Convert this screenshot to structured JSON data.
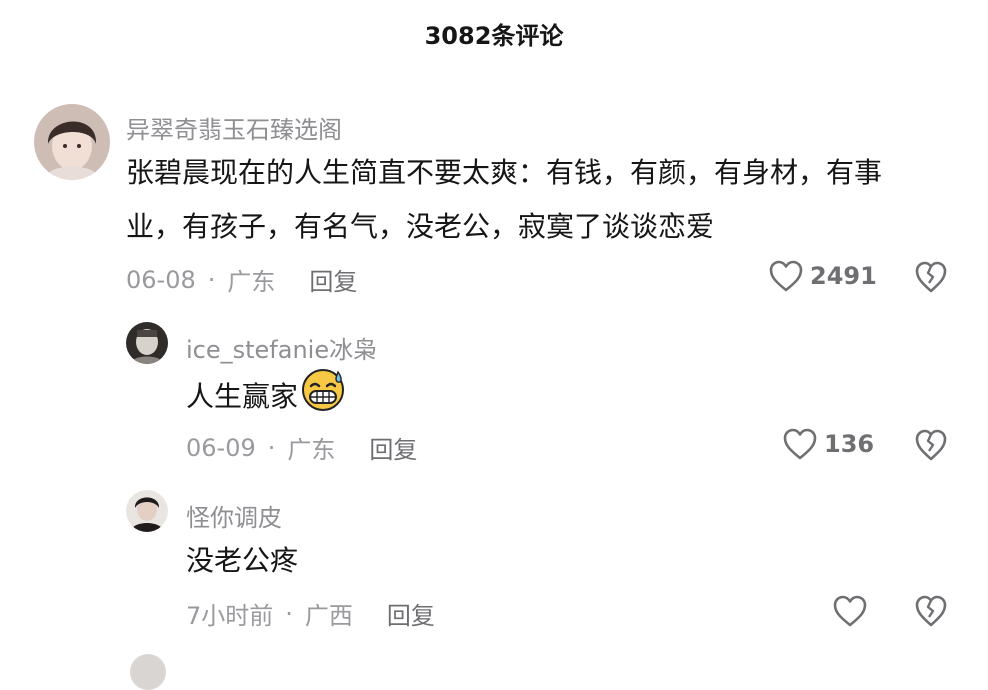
{
  "header": {
    "title": "3082条评论"
  },
  "comments": [
    {
      "username": "异翠奇翡玉石臻选阁",
      "text_line1": "张碧晨现在的人生简直不要太爽：有钱，有颜，有身材，有事",
      "text_line2": "业，有孩子，有名气，没老公，寂寞了谈谈恋爱",
      "date": "06-08",
      "separator": "·",
      "location": "广东",
      "reply_label": "回复",
      "likes": "2491"
    },
    {
      "username": "ice_stefanie冰枭",
      "text": "人生赢家",
      "emoji": "grinning-sweat-emoji",
      "date": "06-09",
      "separator": "·",
      "location": "广东",
      "reply_label": "回复",
      "likes": "136"
    },
    {
      "username": "怪你调皮",
      "text": "没老公疼",
      "date": "7小时前",
      "separator": "·",
      "location": "广西",
      "reply_label": "回复",
      "likes": ""
    }
  ],
  "icons": {
    "like": "heart-outline-icon",
    "dislike": "broken-heart-icon"
  },
  "colors": {
    "text_primary": "#161616",
    "text_secondary": "#8e8e93",
    "icon": "#6f6f73",
    "emoji": "#f7c843"
  }
}
